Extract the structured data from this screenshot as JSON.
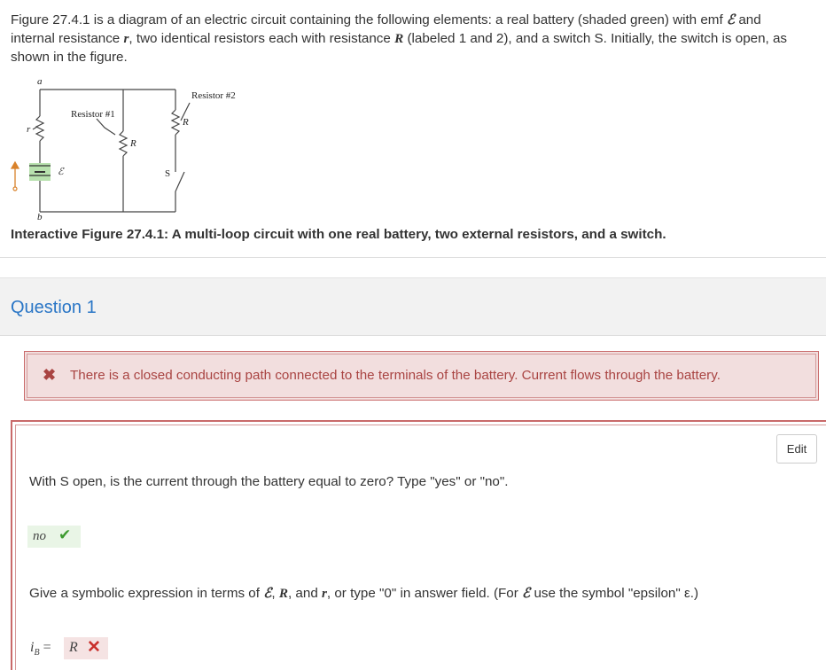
{
  "intro": {
    "line1_a": "Figure 27.4.1 is a diagram of an electric circuit containing the following elements: a real battery (shaded green) with emf ",
    "emf_symbol": "ℰ",
    "line1_b": " and",
    "line2_a": "internal resistance ",
    "r_symbol": "r",
    "line2_b": ", two identical resistors each with resistance ",
    "R_symbol": "R",
    "line2_c": " (labeled 1 and 2), and a switch S. Initially, the switch is open, as",
    "line3": "shown in the figure."
  },
  "figure": {
    "label_a": "a",
    "label_b": "b",
    "label_r": "r",
    "label_emf": "ℰ",
    "label_resistor1": "Resistor #1",
    "label_resistor2": "Resistor #2",
    "label_R1": "R",
    "label_R2": "R",
    "label_S": "S",
    "battery_color": "#7dc96b"
  },
  "caption": "Interactive Figure 27.4.1: A multi-loop circuit with one real battery, two external resistors, and a switch.",
  "question": {
    "title": "Question 1",
    "title_color": "#2a76c6"
  },
  "feedback": {
    "icon": "x-icon",
    "text": "There is a closed conducting path connected to the terminals of the battery. Current flows through the battery.",
    "color": "#a94442"
  },
  "edit_label": "Edit",
  "part1": {
    "prompt": "With S open, is the current through the battery equal to zero? Type \"yes\" or \"no\".",
    "answer": "no",
    "status_icon": "check-icon",
    "status_color": "#3c9a2e"
  },
  "part2": {
    "prompt_a": "Give a symbolic expression in terms of ",
    "sym_emf": "ℰ",
    "sep1": ", ",
    "sym_R": "R",
    "sep2": ", and ",
    "sym_r": "r",
    "prompt_b": ", or type \"0\" in answer field. (For ",
    "sym_emf2": "ℰ",
    "prompt_c": " use the symbol \"epsilon\" ε.)",
    "lhs_var": "i",
    "lhs_sub": "B",
    "equals": " =",
    "answer": "R",
    "status_icon": "x-mark-icon",
    "status_color": "#c9302c"
  }
}
